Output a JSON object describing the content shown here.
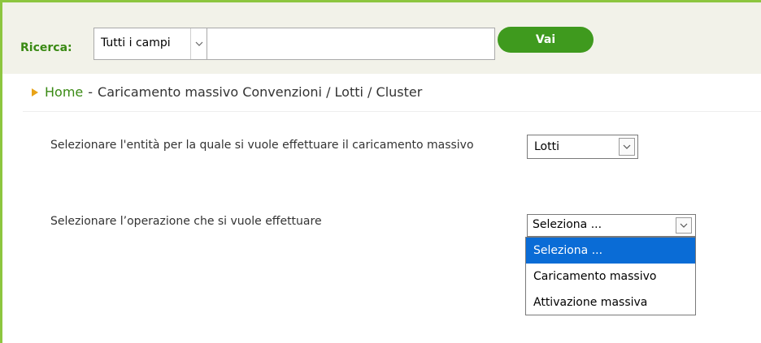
{
  "search": {
    "label": "Ricerca:",
    "field_select_value": "Tutti i campi",
    "input_value": "",
    "go_button": "Vai"
  },
  "breadcrumb": {
    "home": "Home",
    "separator": "-",
    "current": "Caricamento massivo Convenzioni / Lotti / Cluster"
  },
  "form": {
    "entity_label": "Selezionare l'entità per la quale si vuole effettuare il caricamento massivo",
    "entity_value": "Lotti",
    "operation_label": "Selezionare l’operazione che si vuole effettuare",
    "operation_value": "Seleziona ...",
    "operation_options": [
      "Seleziona ...",
      "Caricamento massivo",
      "Attivazione massiva"
    ],
    "operation_selected_index": 0
  },
  "colors": {
    "brand_green": "#3f9a1e",
    "link_green": "#3a8a14",
    "frame_green": "#8dc63f",
    "selection_blue": "#0a6cd6",
    "breadcrumb_arrow": "#e8a317",
    "search_bar_bg": "#f2f2e9"
  },
  "icons": {
    "select_chevron": "chevron-down-icon",
    "breadcrumb_marker": "triangle-right-icon"
  }
}
